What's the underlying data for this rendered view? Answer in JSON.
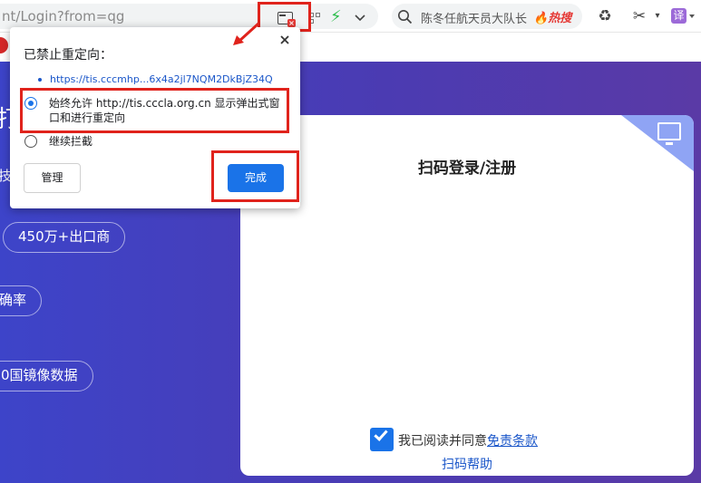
{
  "browser": {
    "address_text": "nt/Login?from=qg",
    "search_text": "陈冬任航天员大队长",
    "search_hot": "热搜",
    "translate_label": "译"
  },
  "popup": {
    "title": "已禁止重定向：",
    "blocked_url": "https://tis.cccmhp...6x4a2jl7NQM2DkBjZ34Q",
    "option_allow": "始终允许 http://tis.cccla.org.cn 显示弹出式窗口和进行重定向",
    "option_block": "继续拦截",
    "selected_option": "allow",
    "manage_label": "管理",
    "done_label": "完成"
  },
  "page": {
    "slice_text": "打",
    "pill_1": "450万+出口商",
    "pill_2": "确率",
    "pill_3": "0国镜像数据"
  },
  "login": {
    "title": "扫码登录/注册",
    "agree_prefix": "我已阅读并同意",
    "terms_link": "免责条款",
    "help_link": "扫码帮助",
    "agree_checked": true
  },
  "colors": {
    "highlight": "#e0231c",
    "accent": "#1a73e8",
    "page_bg": "#4a3fb8"
  }
}
